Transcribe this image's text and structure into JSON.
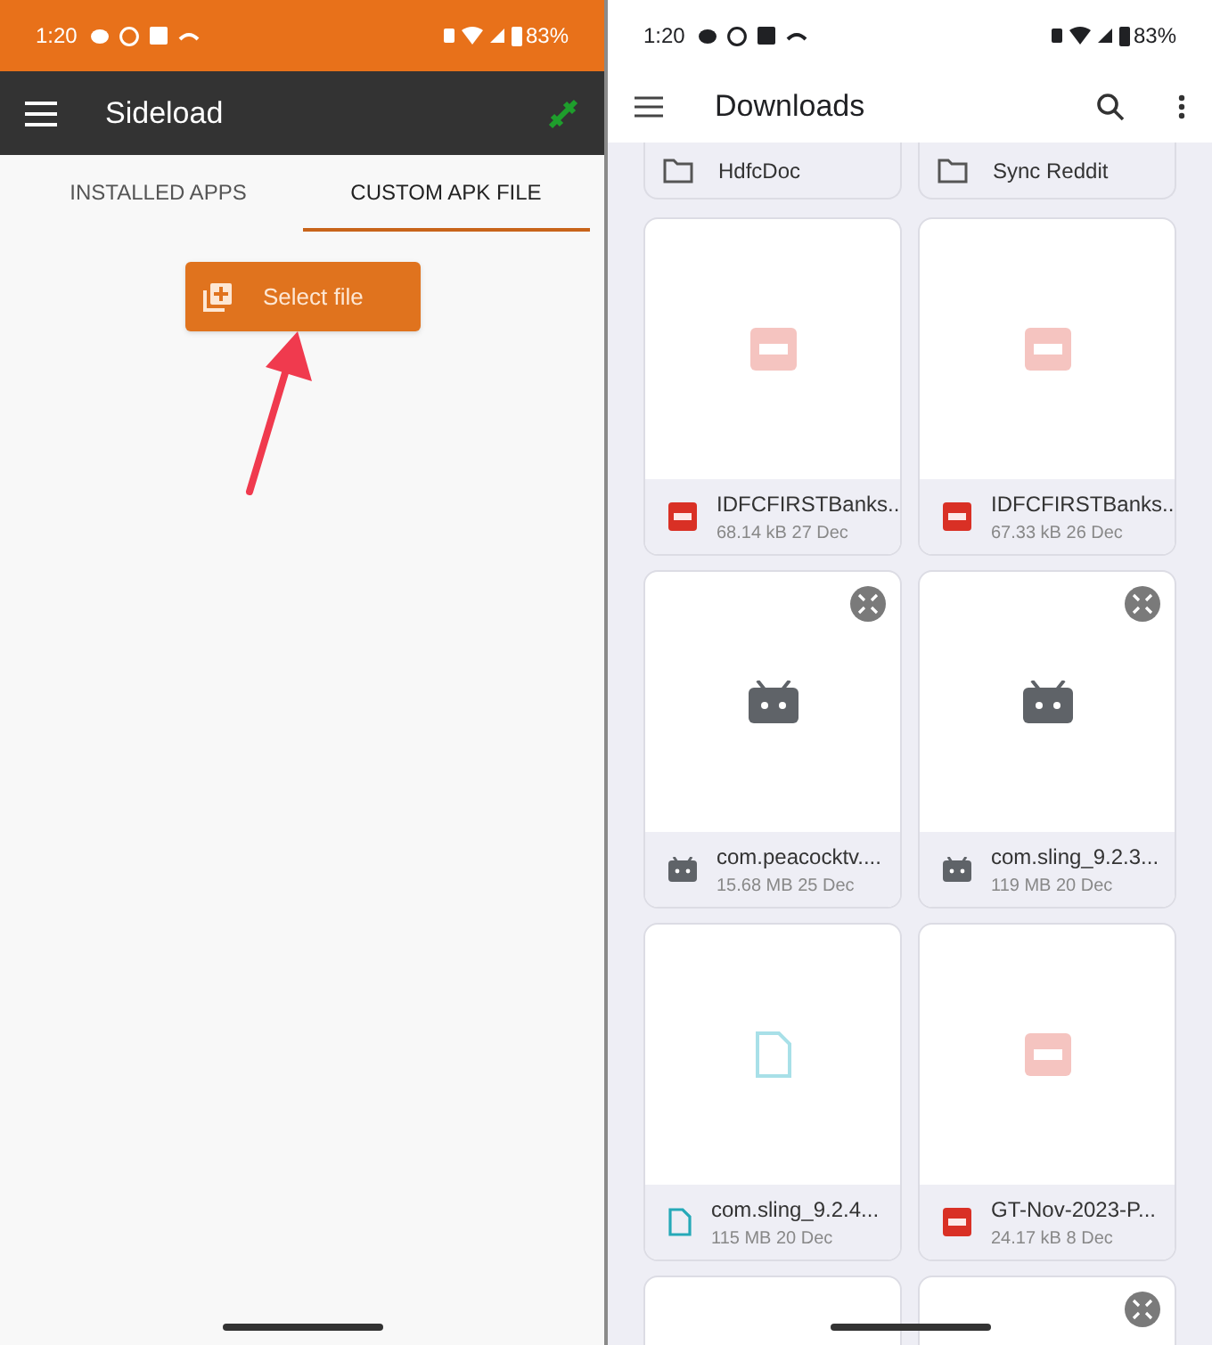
{
  "left_phone": {
    "status_bar": {
      "time": "1:20",
      "battery": "83%"
    },
    "toolbar": {
      "title": "Sideload"
    },
    "tabs": [
      {
        "label": "INSTALLED APPS",
        "selected": false
      },
      {
        "label": "CUSTOM APK FILE",
        "selected": true
      }
    ],
    "select_button": {
      "label": "Select file"
    }
  },
  "right_phone": {
    "status_bar": {
      "time": "1:20",
      "battery": "83%"
    },
    "app_bar": {
      "title": "Downloads"
    },
    "folders": [
      {
        "name": "HdfcDoc"
      },
      {
        "name": "Sync Reddit"
      }
    ],
    "files": [
      {
        "kind": "pdf",
        "name": "IDFCFIRSTBanks...",
        "meta": "68.14 kB 27 Dec",
        "expandable": false
      },
      {
        "kind": "pdf",
        "name": "IDFCFIRSTBanks...",
        "meta": "67.33 kB 26 Dec",
        "expandable": false
      },
      {
        "kind": "apk",
        "name": "com.peacocktv....",
        "meta": "15.68 MB 25 Dec",
        "expandable": true
      },
      {
        "kind": "apk",
        "name": "com.sling_9.2.3...",
        "meta": "119 MB 20 Dec",
        "expandable": true
      },
      {
        "kind": "doc",
        "name": "com.sling_9.2.4...",
        "meta": "115 MB 20 Dec",
        "expandable": false
      },
      {
        "kind": "pdf",
        "name": "GT-Nov-2023-P...",
        "meta": "24.17 kB 8 Dec",
        "expandable": false
      },
      {
        "kind": "cut",
        "expandable": false
      },
      {
        "kind": "cut",
        "expandable": true
      }
    ]
  }
}
